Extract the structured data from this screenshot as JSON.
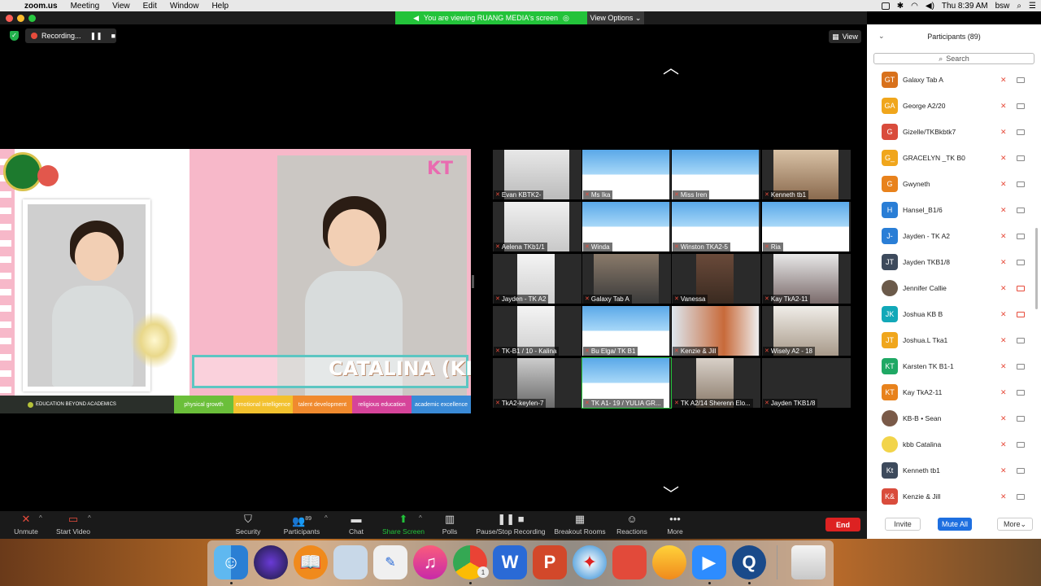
{
  "menubar": {
    "app_name": "zoom.us",
    "items": [
      "Meeting",
      "View",
      "Edit",
      "Window",
      "Help"
    ],
    "clock": "Thu 8:39 AM",
    "user": "bsw"
  },
  "viewing_banner": "You are viewing RUANG MEDIA's screen",
  "view_options": "View Options ⌄",
  "recording": {
    "label": "Recording..."
  },
  "view_button": "View",
  "shared_screen": {
    "logo": "KT",
    "name_caption": "CATALINA (KB B)",
    "banner_motto": "EDUCATION BEYOND ACADEMICS",
    "banner_items": [
      {
        "text": "physical growth",
        "color": "#6bbf3a"
      },
      {
        "text": "emotional intelligence",
        "color": "#f2c12e"
      },
      {
        "text": "talent development",
        "color": "#f08a2e"
      },
      {
        "text": "religious education",
        "color": "#d6449a"
      },
      {
        "text": "academic excellence",
        "color": "#3a8ad6"
      }
    ]
  },
  "gallery": [
    {
      "name": "Evan KBTK2-"
    },
    {
      "name": "Ms Ika"
    },
    {
      "name": "Miss Iren"
    },
    {
      "name": "Kenneth tb1"
    },
    {
      "name": "Aelena TKb1/1"
    },
    {
      "name": "Winda"
    },
    {
      "name": "Winston TKA2-5"
    },
    {
      "name": "Ria"
    },
    {
      "name": "Jayden - TK A2"
    },
    {
      "name": "Galaxy Tab A"
    },
    {
      "name": "Vanessa"
    },
    {
      "name": "Kay TkA2-11"
    },
    {
      "name": "TK-B1 / 10 - Kalina"
    },
    {
      "name": "Bu Elga/ TK B1"
    },
    {
      "name": "Kenzie & Jill"
    },
    {
      "name": "Wisely A2 - 18"
    },
    {
      "name": "TkA2-keylen-7"
    },
    {
      "name": "TK A1- 19 / YULIA GR..."
    },
    {
      "name": "TK A2/14 Sherenn Elo..."
    },
    {
      "name": "Jayden TKB1/8"
    }
  ],
  "participants": {
    "header": "Participants (89)",
    "search_placeholder": "Search",
    "list": [
      {
        "initials": "GT",
        "name": "Galaxy Tab A",
        "color": "#d8711c",
        "cam_off": false
      },
      {
        "initials": "GA",
        "name": "George A2/20",
        "color": "#f0a61c",
        "cam_off": false
      },
      {
        "initials": "G",
        "name": "Gizelle/TKBkbtk7",
        "color": "#d94c3c",
        "cam_off": false
      },
      {
        "initials": "G_",
        "name": "GRACELYN _TK B0",
        "color": "#f0a61c",
        "cam_off": false
      },
      {
        "initials": "G",
        "name": "Gwyneth",
        "color": "#e8821c",
        "cam_off": false
      },
      {
        "initials": "H",
        "name": "Hansel_B1/6",
        "color": "#2a7ed6",
        "cam_off": false
      },
      {
        "initials": "J-",
        "name": "Jayden - TK A2",
        "color": "#2a7ed6",
        "cam_off": false
      },
      {
        "initials": "JT",
        "name": "Jayden TKB1/8",
        "color": "#3d4a5c",
        "cam_off": false
      },
      {
        "initials": "",
        "name": "Jennifer Callie",
        "color": "#6b5a4a",
        "cam_off": true
      },
      {
        "initials": "JK",
        "name": "Joshua KB B",
        "color": "#12a8b8",
        "cam_off": true
      },
      {
        "initials": "JT",
        "name": "Joshua.L Tka1",
        "color": "#f0a61c",
        "cam_off": false
      },
      {
        "initials": "KT",
        "name": "Karsten TK B1-1",
        "color": "#1fa864",
        "cam_off": false
      },
      {
        "initials": "KT",
        "name": "Kay TkA2-11",
        "color": "#e8821c",
        "cam_off": false
      },
      {
        "initials": "",
        "name": "KB-B • Sean",
        "color": "#7a5a48",
        "cam_off": false
      },
      {
        "initials": "",
        "name": "kbb Catalina",
        "color": "#f2d44a",
        "cam_off": false
      },
      {
        "initials": "Kt",
        "name": "Kenneth tb1",
        "color": "#3d4a5c",
        "cam_off": false
      },
      {
        "initials": "K&",
        "name": "Kenzie & Jill",
        "color": "#d94c3c",
        "cam_off": false
      }
    ],
    "invite": "Invite",
    "mute_all": "Mute All",
    "more": "More"
  },
  "toolbar": {
    "unmute": "Unmute",
    "start_video": "Start Video",
    "security": "Security",
    "participants": "Participants",
    "participants_count": "89",
    "chat": "Chat",
    "share_screen": "Share Screen",
    "polls": "Polls",
    "pause_stop_recording": "Pause/Stop Recording",
    "breakout_rooms": "Breakout Rooms",
    "reactions": "Reactions",
    "more": "More",
    "end": "End"
  },
  "dock": {
    "chrome_badge": "1"
  }
}
